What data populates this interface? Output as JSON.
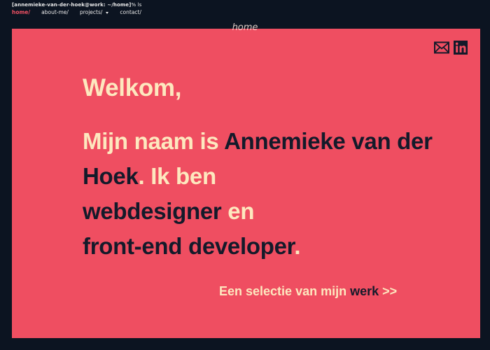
{
  "terminal": {
    "prompt_user": "[annemieke-van-der-hoek@work: ~/home]",
    "prompt_cmd": "% ls"
  },
  "nav": {
    "items": [
      {
        "label": "home/",
        "active": true
      },
      {
        "label": "about-me/",
        "active": false
      },
      {
        "label": "projects/",
        "active": false,
        "has_dropdown": true
      },
      {
        "label": "contact/",
        "active": false
      }
    ]
  },
  "page": {
    "label": "home"
  },
  "social": {
    "icons": [
      "mail-icon",
      "linkedin-icon"
    ]
  },
  "hero": {
    "greeting": "Welkom,",
    "intro_1": "Mijn naam is ",
    "name": "Annemieke van der Hoek",
    "intro_2": ". Ik ben ",
    "role_1": "webdesigner",
    "intro_3": " en ",
    "role_2": "front-end developer",
    "intro_4": "."
  },
  "cta": {
    "text": "Een selectie van mijn ",
    "highlight": "werk",
    "arrows": " >>"
  },
  "colors": {
    "background": "#0c1421",
    "panel": "#ef4e61",
    "cream": "#fde8bf",
    "dark": "#141a2a",
    "active_nav": "#f05163"
  }
}
